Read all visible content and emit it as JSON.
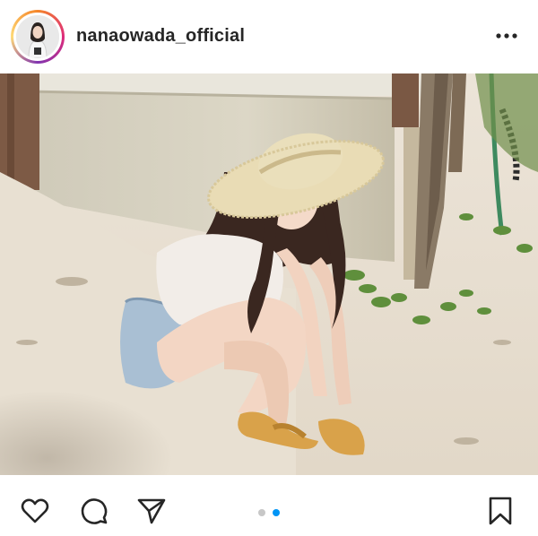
{
  "post": {
    "username": "nanaowada_official",
    "more_icon": "more-horizontal-icon",
    "avatar_icon": "profile-avatar"
  },
  "carousel": {
    "slide_count": 2,
    "active_index": 1,
    "active_color": "#0095f6",
    "inactive_color": "#c7c7c7"
  },
  "actions": {
    "icons": [
      "heart-icon",
      "comment-icon",
      "share-icon",
      "bookmark-icon"
    ]
  }
}
